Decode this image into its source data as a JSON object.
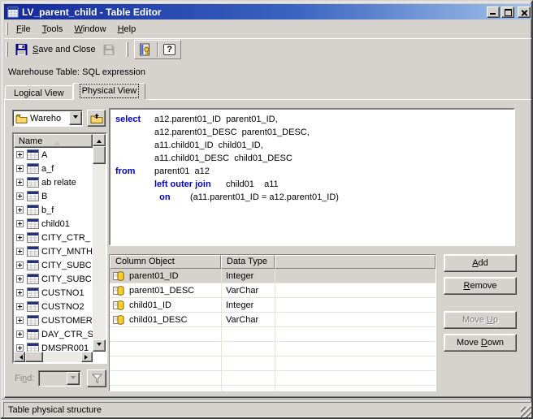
{
  "window": {
    "title": "LV_parent_child - Table Editor"
  },
  "menu": {
    "items": [
      {
        "label": "File",
        "accel": 0
      },
      {
        "label": "Tools",
        "accel": 0
      },
      {
        "label": "Window",
        "accel": 0
      },
      {
        "label": "Help",
        "accel": 0
      }
    ]
  },
  "toolbar": {
    "save_and_close_label": "Save and Close",
    "help_glyph": "?"
  },
  "header": {
    "context_label": "Warehouse Table: SQL expression"
  },
  "tabs": {
    "logical": "Logical View",
    "physical": "Physical View",
    "active": "Physical View"
  },
  "sidebar": {
    "folder_combo": {
      "value": "Wareho"
    },
    "tree": {
      "header": "Name",
      "items": [
        "A",
        "a_f",
        "ab relate",
        "B",
        "b_f",
        "child01",
        "CITY_CTR_",
        "CITY_MNTH",
        "CITY_SUBC",
        "CITY_SUBC",
        "CUSTNO1",
        "CUSTNO2",
        "CUSTOMER",
        "DAY_CTR_S",
        "DMSPR001"
      ]
    },
    "find": {
      "label": "Find:",
      "accel": 2,
      "value": ""
    }
  },
  "sql": {
    "lines": [
      {
        "kw": "select",
        "text": "a12.parent01_ID  parent01_ID,"
      },
      {
        "kw": "",
        "text": "a12.parent01_DESC  parent01_DESC,"
      },
      {
        "kw": "",
        "text": "a11.child01_ID  child01_ID,"
      },
      {
        "kw": "",
        "text": "a11.child01_DESC  child01_DESC"
      },
      {
        "kw": "from",
        "text": "parent01  a12"
      },
      {
        "kw": "",
        "bold": "left outer join",
        "text": "      child01    a11"
      },
      {
        "kw": "",
        "bold": "  on",
        "text": "        (a11.parent01_ID = a12.parent01_ID)"
      }
    ]
  },
  "columns": {
    "headers": {
      "name": "Column Object",
      "type": "Data Type"
    },
    "rows": [
      {
        "name": "parent01_ID",
        "type": "Integer",
        "selected": true
      },
      {
        "name": "parent01_DESC",
        "type": "VarChar",
        "selected": false
      },
      {
        "name": "child01_ID",
        "type": "Integer",
        "selected": false
      },
      {
        "name": "child01_DESC",
        "type": "VarChar",
        "selected": false
      }
    ]
  },
  "actions": {
    "add": {
      "label": "Add",
      "accel": 0,
      "disabled": false
    },
    "remove": {
      "label": "Remove",
      "accel": 0,
      "disabled": false
    },
    "move_up": {
      "label": "Move Up",
      "accel": 5,
      "disabled": true
    },
    "move_down": {
      "label": "Move Down",
      "accel": 5,
      "disabled": false
    }
  },
  "statusbar": {
    "text": "Table physical structure"
  },
  "colors": {
    "title_gradient_start": "#14289b",
    "title_gradient_end": "#a4c2ea",
    "button_face": "#d6d3ce",
    "sql_keyword": "#0000d4",
    "selected_row": "#d6d3ce",
    "folder_yellow": "#ffd76e"
  }
}
